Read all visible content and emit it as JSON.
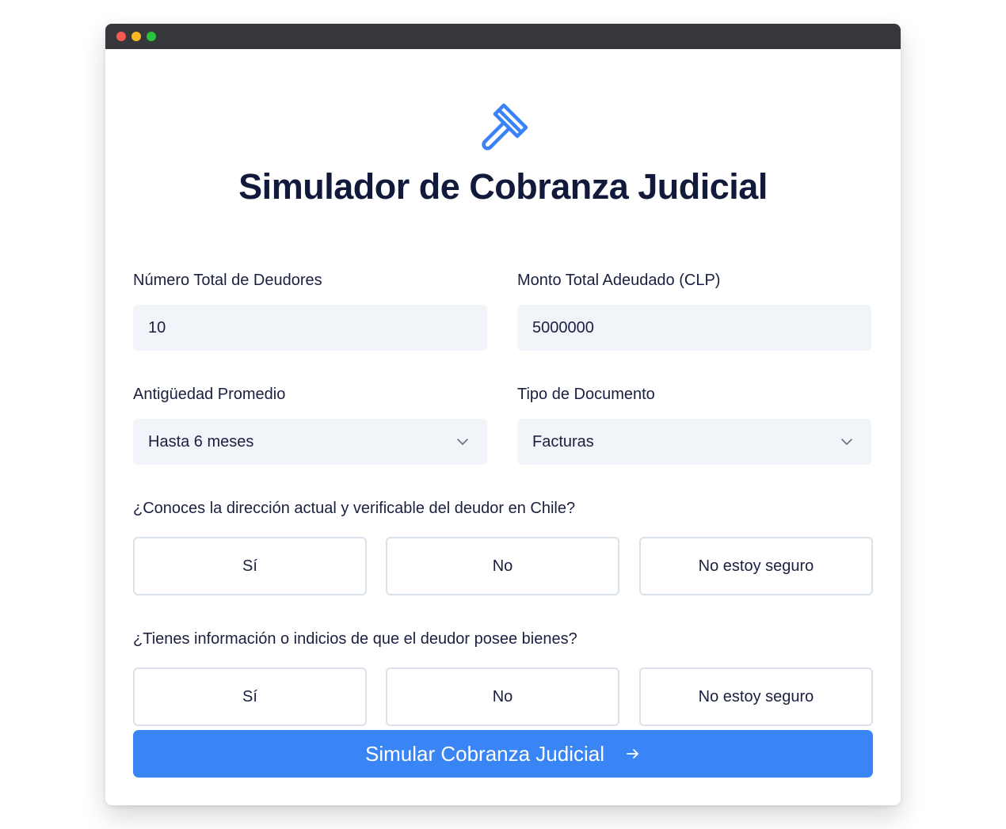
{
  "window": {
    "controls": [
      "close",
      "minimize",
      "maximize"
    ]
  },
  "header": {
    "icon": "gavel-icon",
    "title": "Simulador de Cobranza Judicial",
    "accent_color": "#3b82f6"
  },
  "form": {
    "debtors": {
      "label": "Número Total de Deudores",
      "value": "10"
    },
    "amount": {
      "label": "Monto Total Adeudado (CLP)",
      "value": "5000000"
    },
    "age": {
      "label": "Antigüedad Promedio",
      "value": "Hasta 6 meses",
      "icon": "chevron-down-icon"
    },
    "doc_type": {
      "label": "Tipo de Documento",
      "value": "Facturas",
      "icon": "chevron-down-icon"
    },
    "address_question": {
      "label": "¿Conoces la dirección actual y verificable del deudor en Chile?",
      "options": [
        "Sí",
        "No",
        "No estoy seguro"
      ]
    },
    "assets_question": {
      "label": "¿Tienes información o indicios de que el deudor posee bienes?",
      "options": [
        "Sí",
        "No",
        "No estoy seguro"
      ]
    },
    "submit": {
      "label": "Simular Cobranza Judicial",
      "icon": "arrow-right-icon",
      "color": "#3985f6"
    }
  }
}
